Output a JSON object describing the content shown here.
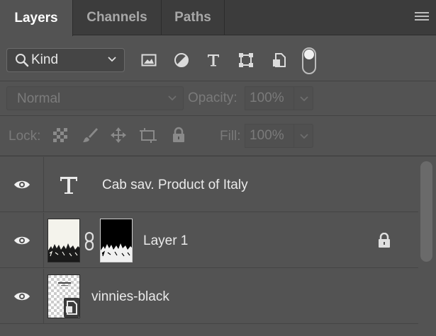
{
  "tabs": [
    {
      "label": "Layers",
      "active": true
    },
    {
      "label": "Channels",
      "active": false
    },
    {
      "label": "Paths",
      "active": false
    }
  ],
  "filter": {
    "kind_label": "Kind",
    "icons": [
      "image-filter-icon",
      "adjustment-filter-icon",
      "type-filter-icon",
      "shape-filter-icon",
      "smart-object-filter-icon"
    ],
    "filter_toggle_on": true
  },
  "blend": {
    "mode": "Normal",
    "opacity_label": "Opacity:",
    "opacity_value": "100%"
  },
  "lock": {
    "label": "Lock:",
    "fill_label": "Fill:",
    "fill_value": "100%"
  },
  "layers": [
    {
      "name": "Cab sav.  Product of Italy",
      "type": "text",
      "visible": true,
      "locked": false
    },
    {
      "name": "Layer 1",
      "type": "pixel-with-mask",
      "visible": true,
      "locked": true
    },
    {
      "name": "vinnies-black",
      "type": "smart-object",
      "visible": true,
      "locked": false
    }
  ],
  "colors": {
    "panel_bg": "#535353",
    "tab_bar_bg": "#3c3c3c",
    "text_primary": "#eaeaea",
    "text_disabled": "#7a7a7a"
  }
}
